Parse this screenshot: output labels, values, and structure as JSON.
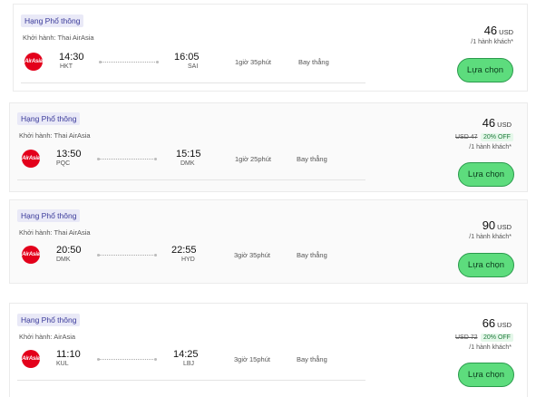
{
  "flights": [
    {
      "class_label": "Hạng Phổ thông",
      "carrier": "Khởi hành: Thai AirAsia",
      "logo_text": "AirAsia",
      "dep_time": "14:30",
      "dep_code": "HKT",
      "arr_time": "16:05",
      "arr_code": "SAI",
      "duration": "1giờ 35phút",
      "stops": "Bay thẳng",
      "price": "46",
      "currency": "USD",
      "per": "/1 hành khách*",
      "old_price": "",
      "discount": "",
      "select_label": "Lựa chọn"
    },
    {
      "class_label": "Hạng Phổ thông",
      "carrier": "Khởi hành: Thai AirAsia",
      "logo_text": "AirAsia",
      "dep_time": "13:50",
      "dep_code": "PQC",
      "arr_time": "15:15",
      "arr_code": "DMK",
      "duration": "1giờ 25phút",
      "stops": "Bay thẳng",
      "price": "46",
      "currency": "USD",
      "per": "/1 hành khách*",
      "old_price": "USD 47",
      "discount": "20% OFF",
      "select_label": "Lựa chọn"
    },
    {
      "class_label": "Hạng Phổ thông",
      "carrier": "Khởi hành: Thai AirAsia",
      "logo_text": "AirAsia",
      "dep_time": "20:50",
      "dep_code": "DMK",
      "arr_time": "22:55",
      "arr_code": "HYD",
      "duration": "3giờ 35phút",
      "stops": "Bay thẳng",
      "price": "90",
      "currency": "USD",
      "per": "/1 hành khách*",
      "old_price": "",
      "discount": "",
      "select_label": "Lựa chọn"
    },
    {
      "class_label": "Hạng Phổ thông",
      "carrier": "Khởi hành: AirAsia",
      "logo_text": "AirAsia",
      "dep_time": "11:10",
      "dep_code": "KUL",
      "arr_time": "14:25",
      "arr_code": "LBJ",
      "duration": "3giờ 15phút",
      "stops": "Bay thẳng",
      "price": "66",
      "currency": "USD",
      "per": "/1 hành khách*",
      "old_price": "USD 72",
      "discount": "20% OFF",
      "select_label": "Lựa chọn"
    }
  ],
  "colors": {
    "select_button": "#5ddc7d",
    "discount_badge": "#e4f7e9",
    "class_badge": "#e9e9f7",
    "airline_logo": "#e3001b"
  }
}
